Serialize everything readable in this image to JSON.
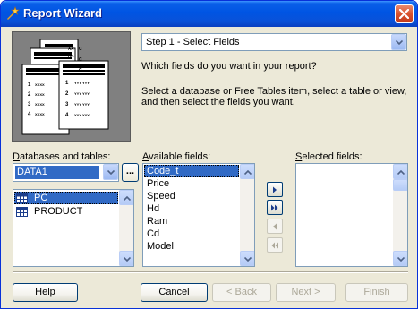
{
  "window": {
    "title": "Report Wizard",
    "icon": "wizard-icon",
    "close": "close-icon"
  },
  "preview": {
    "rows_front": [
      {
        "num": "1",
        "text": "YYY YYY"
      },
      {
        "num": "2",
        "text": "YYY YYY"
      },
      {
        "num": "3",
        "text": "YYY YYY"
      },
      {
        "num": "4",
        "text": "YYY YYY"
      }
    ],
    "rows_back": [
      {
        "num": "1",
        "text": "XXXX"
      },
      {
        "num": "2",
        "text": "XXXX"
      },
      {
        "num": "3",
        "text": "XXXX"
      },
      {
        "num": "4",
        "text": "XXXX"
      }
    ],
    "back_letters": [
      "AA",
      "AA"
    ],
    "side_letters": [
      "C",
      "C",
      "C"
    ]
  },
  "step_select": {
    "value": "Step 1 - Select Fields"
  },
  "question": "Which fields do you want in your report?",
  "instructions": "Select a database or Free Tables item, select a table or view, and then select the fields you want.",
  "databases": {
    "label_u": "D",
    "label_rest": "atabases and tables:",
    "selected_db": "DATA1",
    "browse_label": "...",
    "tables": [
      {
        "name": "PC",
        "selected": true
      },
      {
        "name": "PRODUCT",
        "selected": false
      }
    ]
  },
  "available": {
    "label_u": "A",
    "label_rest": "vailable fields:",
    "fields": [
      "Code_t",
      "Price",
      "Speed",
      "Hd",
      "Ram",
      "Cd",
      "Model"
    ]
  },
  "selected": {
    "label_u": "S",
    "label_rest": "elected fields:",
    "fields": []
  },
  "buttons": {
    "help_u": "H",
    "help_rest": "elp",
    "cancel": "Cancel",
    "back_pre": "< ",
    "back_u": "B",
    "back_rest": "ack",
    "next_pre": "",
    "next_u": "N",
    "next_rest": "ext >",
    "finish_u": "F",
    "finish_rest": "inish"
  }
}
